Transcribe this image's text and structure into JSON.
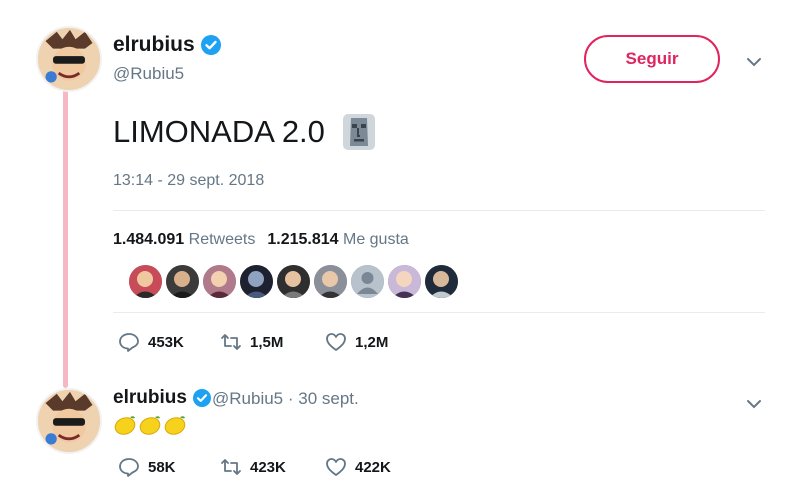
{
  "tweet": {
    "author": {
      "name": "elrubius",
      "handle": "@Rubiu5"
    },
    "follow_label": "Seguir",
    "text": "LIMONADA 2.0",
    "emoji_icon": "moai-icon",
    "timestamp": "13:14 - 29 sept. 2018",
    "stats": {
      "retweets_count": "1.484.091",
      "retweets_label": "Retweets",
      "likes_count": "1.215.814",
      "likes_label": "Me gusta"
    },
    "liker_avatar_count": 9,
    "actions": {
      "replies": "453K",
      "retweets": "1,5M",
      "likes": "1,2M"
    }
  },
  "reply": {
    "author": {
      "name": "elrubius",
      "handle": "@Rubiu5"
    },
    "date": "· 30 sept.",
    "emoji_icons": [
      "lemon-icon",
      "lemon-icon",
      "lemon-icon"
    ],
    "actions": {
      "replies": "58K",
      "retweets": "423K",
      "likes": "422K"
    }
  },
  "colors": {
    "accent": "#e0245e",
    "verified": "#1da1f2",
    "secondary_text": "#657786",
    "thread_line": "#f5b8c4"
  }
}
